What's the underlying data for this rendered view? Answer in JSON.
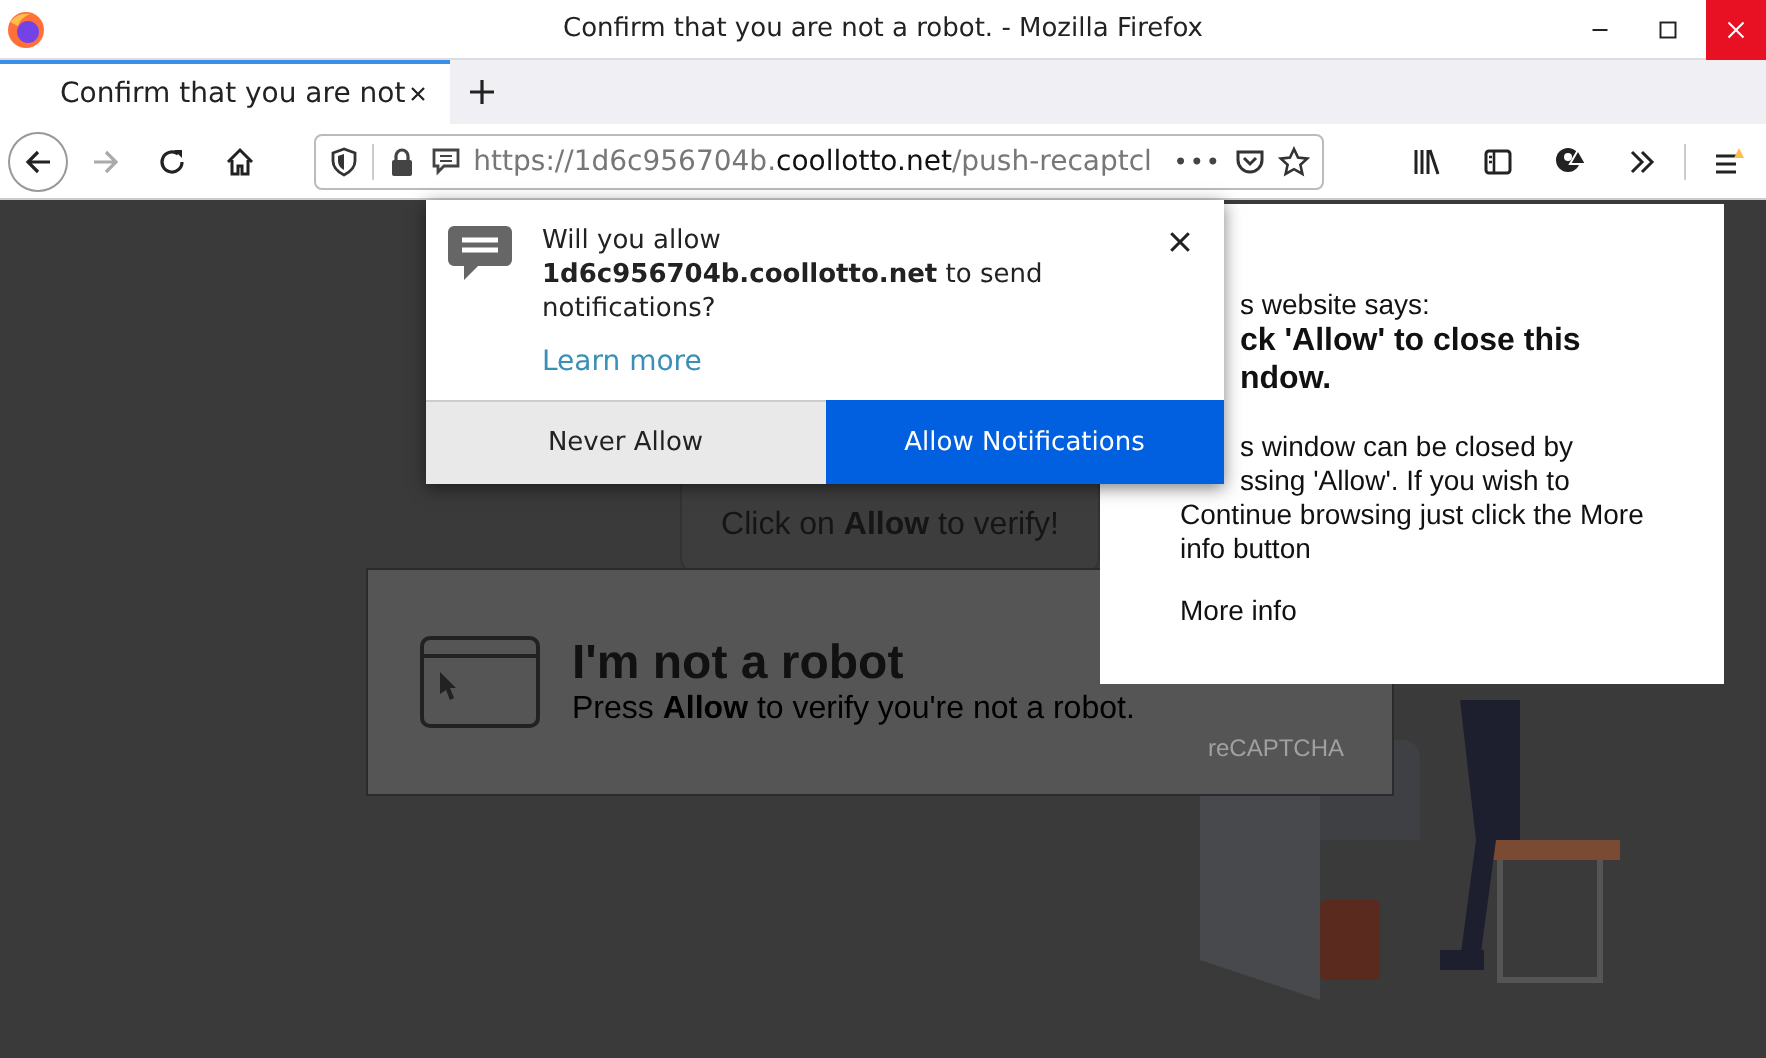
{
  "window": {
    "title": "Confirm that you are not a robot. - Mozilla Firefox"
  },
  "tabs": [
    {
      "label": "Confirm that you are not",
      "selected": true
    }
  ],
  "toolbar": {
    "url": {
      "prefix": "https://1d6c956704b.",
      "domain": "coollotto.net",
      "path": "/push-recaptcl"
    },
    "forward_disabled": true,
    "page_actions": "•••"
  },
  "notification_popup": {
    "message": "Will you allow **1d6c956704b.coollotto.net** to send notifications?",
    "link": "Learn more",
    "buttons": [
      {
        "label": "Never Allow",
        "kind": "secondary"
      },
      {
        "label": "Allow Notifications",
        "kind": "primary"
      }
    ]
  },
  "page": {
    "verify_hint": "Click on **Allow** to verify!",
    "captcha": {
      "title": "I'm not a robot",
      "subtitle": "Press **Allow** to verify you're not a robot.",
      "brand": "reCAPTCHA"
    }
  },
  "site_dialog": {
    "lines": [
      {
        "text": "s website says:",
        "kind": "covered"
      },
      {
        "text": "ck 'Allow' to close this",
        "kind": "covered-bold"
      },
      {
        "text": "ndow.",
        "kind": "covered-bold"
      },
      {
        "text": "s window can be closed by",
        "kind": "covered-body"
      },
      {
        "text": "ssing 'Allow'. If you wish to",
        "kind": "covered-body"
      },
      {
        "text": "Continue browsing just click the More",
        "kind": "body"
      },
      {
        "text": "info button",
        "kind": "body"
      }
    ],
    "link": "More info"
  }
}
